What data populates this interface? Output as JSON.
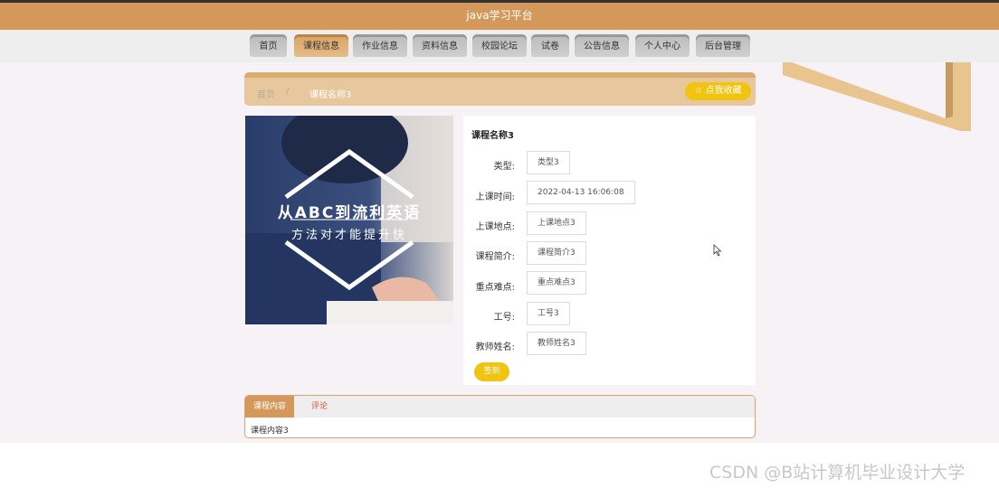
{
  "header": {
    "title": "java学习平台"
  },
  "nav": {
    "items": [
      {
        "label": "首页"
      },
      {
        "label": "课程信息"
      },
      {
        "label": "作业信息"
      },
      {
        "label": "资料信息"
      },
      {
        "label": "校园论坛"
      },
      {
        "label": "试卷"
      },
      {
        "label": "公告信息"
      },
      {
        "label": "个人中心"
      },
      {
        "label": "后台管理"
      }
    ],
    "active_index": 1
  },
  "breadcrumb": {
    "home": "首页",
    "separator": "/",
    "current": "课程名称3",
    "favorite_label": "☆ 点我收藏"
  },
  "course_image": {
    "headline": "从ABC到流利英语",
    "subline": "方法对才能提升快"
  },
  "course": {
    "title": "课程名称3",
    "fields": [
      {
        "label": "类型:",
        "value": "类型3"
      },
      {
        "label": "上课时间:",
        "value": "2022-04-13 16:06:08"
      },
      {
        "label": "上课地点:",
        "value": "上课地点3"
      },
      {
        "label": "课程简介:",
        "value": "课程简介3"
      },
      {
        "label": "重点难点:",
        "value": "重点难点3"
      },
      {
        "label": "工号:",
        "value": "工号3"
      },
      {
        "label": "教师姓名:",
        "value": "教师姓名3"
      }
    ],
    "sign_button": "签到"
  },
  "tabs": {
    "items": [
      {
        "label": "课程内容"
      },
      {
        "label": "评论"
      }
    ],
    "content": "课程内容3"
  },
  "watermark": "CSDN @B站计算机毕业设计大学",
  "colors": {
    "brand": "#d4995a",
    "button_yellow": "#f1c40f"
  }
}
